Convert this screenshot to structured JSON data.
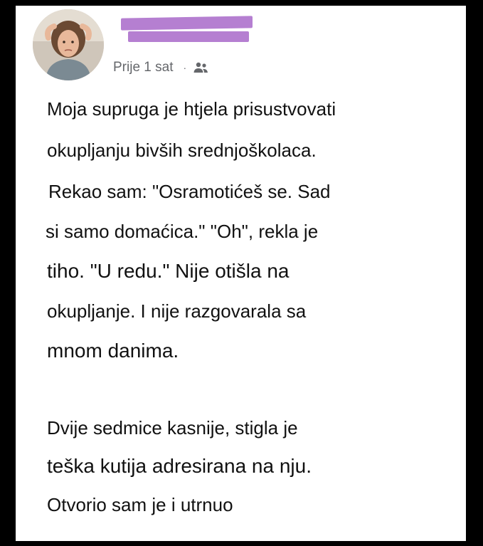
{
  "post": {
    "timestamp": "Prije 1 sat",
    "separator": "·",
    "audience_icon": "friends-icon",
    "paragraph1": [
      "Moja supruga je htjela prisustvovati",
      "okupljanju bivših srednjoškolaca.",
      "Rekao sam: \"Osramotićeš se. Sad",
      "si samo domaćica.\" \"Oh\", rekla je",
      "tiho. \"U redu.\" Nije otišla na",
      "okupljanje. I nije razgovarala sa",
      "mnom danima."
    ],
    "paragraph2": [
      "Dvije sedmice kasnije, stigla je",
      "teška kutija adresirana na nju.",
      "Otvorio sam je i utrnuo"
    ]
  },
  "colors": {
    "background": "#000000",
    "card": "#ffffff",
    "redaction": "#b57fd1",
    "meta_text": "#65676b",
    "body_text": "#111111"
  }
}
